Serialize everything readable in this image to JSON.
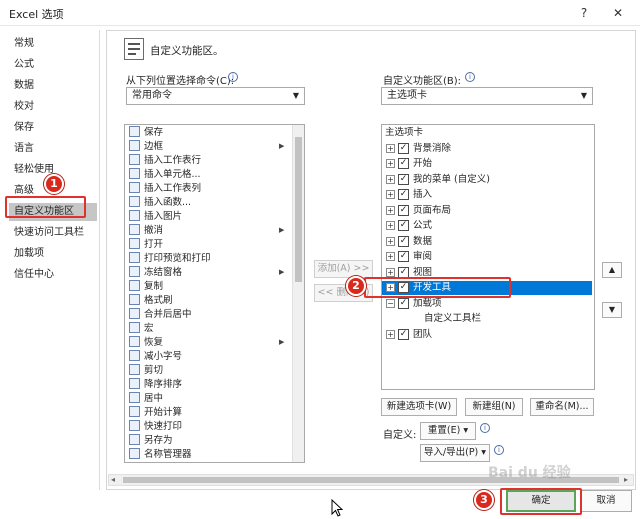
{
  "window": {
    "title": "Excel 选项",
    "help": "?",
    "close": "✕"
  },
  "nav": {
    "items": [
      "常规",
      "公式",
      "数据",
      "校对",
      "保存",
      "语言",
      "轻松使用",
      "高级",
      "自定义功能区",
      "快速访问工具栏",
      "加载项",
      "信任中心"
    ],
    "active_index": 8
  },
  "header": {
    "title": "自定义功能区。"
  },
  "left": {
    "label": "从下列位置选择命令(C):",
    "combo_value": "常用命令",
    "commands": [
      {
        "label": "保存",
        "more": false
      },
      {
        "label": "边框",
        "more": true
      },
      {
        "label": "插入工作表行",
        "more": false
      },
      {
        "label": "插入单元格...",
        "more": false
      },
      {
        "label": "插入工作表列",
        "more": false
      },
      {
        "label": "插入函数...",
        "more": false
      },
      {
        "label": "插入图片",
        "more": false
      },
      {
        "label": "撤消",
        "more": true
      },
      {
        "label": "打开",
        "more": false
      },
      {
        "label": "打印预览和打印",
        "more": false
      },
      {
        "label": "冻结窗格",
        "more": true
      },
      {
        "label": "复制",
        "more": false
      },
      {
        "label": "格式刷",
        "more": false
      },
      {
        "label": "合并后居中",
        "more": false
      },
      {
        "label": "宏",
        "more": false
      },
      {
        "label": "恢复",
        "more": true
      },
      {
        "label": "减小字号",
        "more": false
      },
      {
        "label": "剪切",
        "more": false
      },
      {
        "label": "降序排序",
        "more": false
      },
      {
        "label": "居中",
        "more": false
      },
      {
        "label": "开始计算",
        "more": false
      },
      {
        "label": "快速打印",
        "more": false
      },
      {
        "label": "另存为",
        "more": false
      },
      {
        "label": "名称管理器",
        "more": false
      }
    ]
  },
  "middle": {
    "add": "添加(A) >>",
    "remove": "<< 删除(R)"
  },
  "right": {
    "label": "自定义功能区(B):",
    "combo_value": "主选项卡",
    "tree": [
      {
        "label": "主选项卡",
        "indent": 0,
        "expander": "",
        "checked": null,
        "selected": false
      },
      {
        "label": "背景消除",
        "indent": 1,
        "expander": "+",
        "checked": true,
        "selected": false
      },
      {
        "label": "开始",
        "indent": 1,
        "expander": "+",
        "checked": true,
        "selected": false
      },
      {
        "label": "我的菜单 (自定义)",
        "indent": 1,
        "expander": "+",
        "checked": true,
        "selected": false
      },
      {
        "label": "插入",
        "indent": 1,
        "expander": "+",
        "checked": true,
        "selected": false
      },
      {
        "label": "页面布局",
        "indent": 1,
        "expander": "+",
        "checked": true,
        "selected": false
      },
      {
        "label": "公式",
        "indent": 1,
        "expander": "+",
        "checked": true,
        "selected": false
      },
      {
        "label": "数据",
        "indent": 1,
        "expander": "+",
        "checked": true,
        "selected": false
      },
      {
        "label": "审阅",
        "indent": 1,
        "expander": "+",
        "checked": true,
        "selected": false
      },
      {
        "label": "视图",
        "indent": 1,
        "expander": "+",
        "checked": true,
        "selected": false
      },
      {
        "label": "开发工具",
        "indent": 1,
        "expander": "+",
        "checked": true,
        "selected": true
      },
      {
        "label": "加载项",
        "indent": 1,
        "expander": "−",
        "checked": true,
        "selected": false
      },
      {
        "label": "自定义工具栏",
        "indent": 3,
        "expander": "",
        "checked": null,
        "selected": false
      },
      {
        "label": "团队",
        "indent": 1,
        "expander": "+",
        "checked": true,
        "selected": false
      }
    ],
    "new_tab": "新建选项卡(W)",
    "new_group": "新建组(N)",
    "rename": "重命名(M)...",
    "customize_label": "自定义:",
    "reset": "重置(E) ▾",
    "import_export": "导入/导出(P) ▾"
  },
  "footer": {
    "ok": "确定",
    "cancel": "取消"
  },
  "badges": {
    "one": "1",
    "two": "2",
    "three": "3"
  },
  "watermark": "Bai du 经验"
}
